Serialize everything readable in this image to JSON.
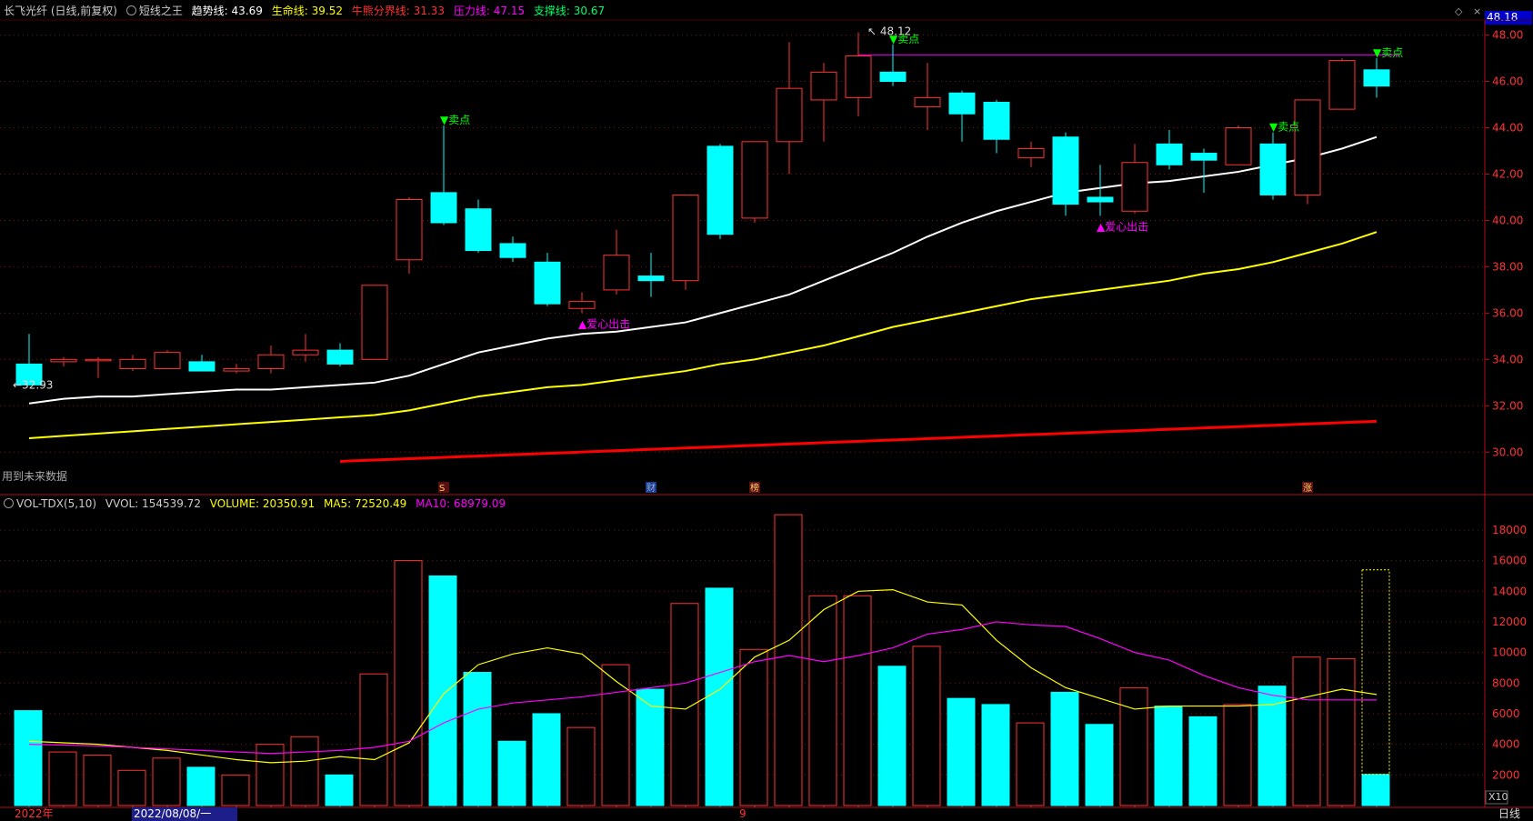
{
  "colors": {
    "background": "#000000",
    "up": "#ff3232",
    "down": "#00ffff",
    "grid": "#7a1010",
    "trend": "#ffffff",
    "life": "#ffff00",
    "bullbear": "#ff0000",
    "pressure": "#ff00ff",
    "support": "#00ff00",
    "signal_sell": "#00ff00",
    "signal_buy": "#ff00ff"
  },
  "header": {
    "stock": "长飞光纤 (日线,前复权)",
    "indicator": "短线之王",
    "trend_label": "趋势线:",
    "trend_value": "43.69",
    "life_label": "生命线:",
    "life_value": "39.52",
    "bullbear_label": "牛熊分界线:",
    "bullbear_value": "31.33",
    "pressure_label": "压力线:",
    "pressure_value": "47.15",
    "support_label": "支撑线:",
    "support_value": "30.67",
    "top_right_price": "48.18"
  },
  "vol_header": {
    "name": "VOL-TDX(5,10)",
    "vvol": "VVOL: 154539.72",
    "volume": "VOLUME: 20350.91",
    "ma5": "MA5: 72520.49",
    "ma10": "MA10: 68979.09"
  },
  "labels": {
    "future_data": "用到未来数据",
    "high_label": "48.12",
    "low_label": "32.93",
    "sell_signal": "▼卖点",
    "buy_signal": "▲爱心出击",
    "event_markers": [
      "S",
      "财",
      "榜",
      "涨"
    ],
    "bottom_year": "2022年",
    "bottom_date": "2022/08/08/一",
    "bottom_month": "9",
    "period": "日线",
    "scale_x10": "X10"
  },
  "price_axis": {
    "min": 29.5,
    "max": 48.18,
    "ticks": [
      "48.00",
      "46.00",
      "44.00",
      "42.00",
      "40.00",
      "38.00",
      "36.00",
      "34.00",
      "32.00",
      "30.00"
    ]
  },
  "volume_axis": {
    "min": 0,
    "max": 19600,
    "ticks": [
      "18000",
      "16000",
      "14000",
      "12000",
      "10000",
      "8000",
      "6000",
      "4000",
      "2000"
    ]
  },
  "chart_data": [
    {
      "type": "candlestick",
      "title": "长飞光纤 (日线,前复权)",
      "series_ohlc": [
        [
          33.8,
          35.1,
          32.93,
          32.9
        ],
        [
          33.9,
          34.1,
          33.7,
          34.0
        ],
        [
          34.0,
          34.1,
          33.2,
          34.0
        ],
        [
          33.6,
          34.2,
          33.5,
          34.0
        ],
        [
          33.6,
          34.4,
          33.6,
          34.3
        ],
        [
          33.9,
          34.2,
          33.5,
          33.5
        ],
        [
          33.5,
          33.8,
          33.4,
          33.6
        ],
        [
          33.6,
          34.6,
          33.4,
          34.2
        ],
        [
          34.2,
          35.1,
          33.9,
          34.4
        ],
        [
          34.4,
          34.7,
          33.7,
          33.8
        ],
        [
          34.0,
          37.2,
          34.0,
          37.2
        ],
        [
          38.3,
          41.0,
          37.7,
          40.9
        ],
        [
          41.2,
          44.1,
          39.8,
          39.9
        ],
        [
          40.5,
          40.9,
          38.6,
          38.7
        ],
        [
          39.0,
          39.3,
          38.2,
          38.4
        ],
        [
          38.2,
          38.6,
          36.3,
          36.4
        ],
        [
          36.2,
          36.9,
          36.0,
          36.5
        ],
        [
          37.0,
          39.6,
          36.8,
          38.5
        ],
        [
          37.6,
          38.6,
          36.7,
          37.4
        ],
        [
          37.4,
          41.1,
          37.0,
          41.1
        ],
        [
          43.2,
          43.3,
          39.2,
          39.4
        ],
        [
          40.1,
          43.4,
          39.9,
          43.4
        ],
        [
          43.4,
          47.7,
          42.0,
          45.7
        ],
        [
          45.2,
          46.8,
          43.4,
          46.4
        ],
        [
          45.3,
          48.12,
          44.5,
          47.1
        ],
        [
          46.4,
          47.6,
          45.8,
          46.0
        ],
        [
          44.9,
          46.8,
          43.9,
          45.3
        ],
        [
          45.5,
          45.6,
          43.4,
          44.6
        ],
        [
          45.1,
          45.2,
          42.9,
          43.5
        ],
        [
          42.7,
          43.4,
          42.3,
          43.1
        ],
        [
          43.6,
          43.8,
          40.2,
          40.7
        ],
        [
          41.0,
          42.4,
          40.2,
          40.8
        ],
        [
          40.4,
          43.3,
          40.3,
          42.5
        ],
        [
          43.3,
          43.9,
          42.2,
          42.4
        ],
        [
          42.9,
          43.1,
          41.2,
          42.6
        ],
        [
          42.4,
          44.1,
          42.4,
          44.0
        ],
        [
          43.3,
          43.8,
          40.9,
          41.1
        ],
        [
          41.1,
          45.0,
          40.7,
          45.2
        ],
        [
          44.8,
          47.0,
          44.8,
          46.9
        ],
        [
          46.5,
          47.0,
          45.3,
          45.8
        ]
      ],
      "trend_line": [
        32.1,
        32.3,
        32.4,
        32.4,
        32.5,
        32.6,
        32.7,
        32.7,
        32.8,
        32.9,
        33.0,
        33.3,
        33.8,
        34.3,
        34.6,
        34.9,
        35.1,
        35.2,
        35.4,
        35.6,
        36.0,
        36.4,
        36.8,
        37.4,
        38.0,
        38.6,
        39.3,
        39.9,
        40.4,
        40.8,
        41.2,
        41.4,
        41.6,
        41.7,
        41.9,
        42.1,
        42.4,
        42.7,
        43.1,
        43.6
      ],
      "life_line": [
        30.6,
        30.7,
        30.8,
        30.9,
        31.0,
        31.1,
        31.2,
        31.3,
        31.4,
        31.5,
        31.6,
        31.8,
        32.1,
        32.4,
        32.6,
        32.8,
        32.9,
        33.1,
        33.3,
        33.5,
        33.8,
        34.0,
        34.3,
        34.6,
        35.0,
        35.4,
        35.7,
        36.0,
        36.3,
        36.6,
        36.8,
        37.0,
        37.2,
        37.4,
        37.7,
        37.9,
        38.2,
        38.6,
        39.0,
        39.5
      ],
      "bullbear_line": {
        "start_index": 9,
        "from": 29.6,
        "to": 31.33
      },
      "pressure_line": {
        "start_index": 24,
        "value": 47.15
      },
      "signals": [
        {
          "index": 12,
          "type": "sell",
          "price": 44.1
        },
        {
          "index": 16,
          "type": "buy",
          "price": 36.0
        },
        {
          "index": 25,
          "type": "sell",
          "price": 47.6
        },
        {
          "index": 31,
          "type": "buy",
          "price": 40.2
        },
        {
          "index": 36,
          "type": "sell",
          "price": 43.8
        },
        {
          "index": 39,
          "type": "sell",
          "price": 47.0
        }
      ],
      "event_marker_indices": [
        12,
        18,
        21,
        37
      ]
    },
    {
      "type": "bar",
      "title": "VOL-TDX(5,10)",
      "volumes": [
        6200,
        3500,
        3300,
        2300,
        3100,
        2500,
        2000,
        4000,
        4500,
        2000,
        8600,
        16000,
        15000,
        8700,
        4200,
        6000,
        5100,
        9200,
        7600,
        13200,
        14200,
        10200,
        19000,
        13700,
        13700,
        9100,
        10400,
        7000,
        6600,
        5400,
        7400,
        5300,
        7700,
        6500,
        5800,
        6600,
        7800,
        9700,
        9600,
        2035
      ],
      "ma5": [
        4200,
        4100,
        4000,
        3800,
        3600,
        3300,
        3000,
        2800,
        2900,
        3200,
        3000,
        4100,
        7300,
        9200,
        9900,
        10300,
        9900,
        8100,
        6500,
        6300,
        7600,
        9700,
        10800,
        12800,
        14000,
        14100,
        13300,
        13100,
        10800,
        9000,
        7700,
        7000,
        6300,
        6500,
        6500,
        6500,
        6600,
        7100,
        7600,
        7252
      ],
      "ma10": [
        4000,
        3950,
        3900,
        3800,
        3700,
        3600,
        3500,
        3400,
        3500,
        3600,
        3800,
        4200,
        5400,
        6300,
        6700,
        6900,
        7100,
        7400,
        7700,
        8000,
        8700,
        9400,
        9800,
        9400,
        9800,
        10300,
        11200,
        11500,
        12000,
        11800,
        11700,
        10900,
        10000,
        9500,
        8500,
        7700,
        7200,
        6900,
        6900,
        6898
      ]
    }
  ]
}
